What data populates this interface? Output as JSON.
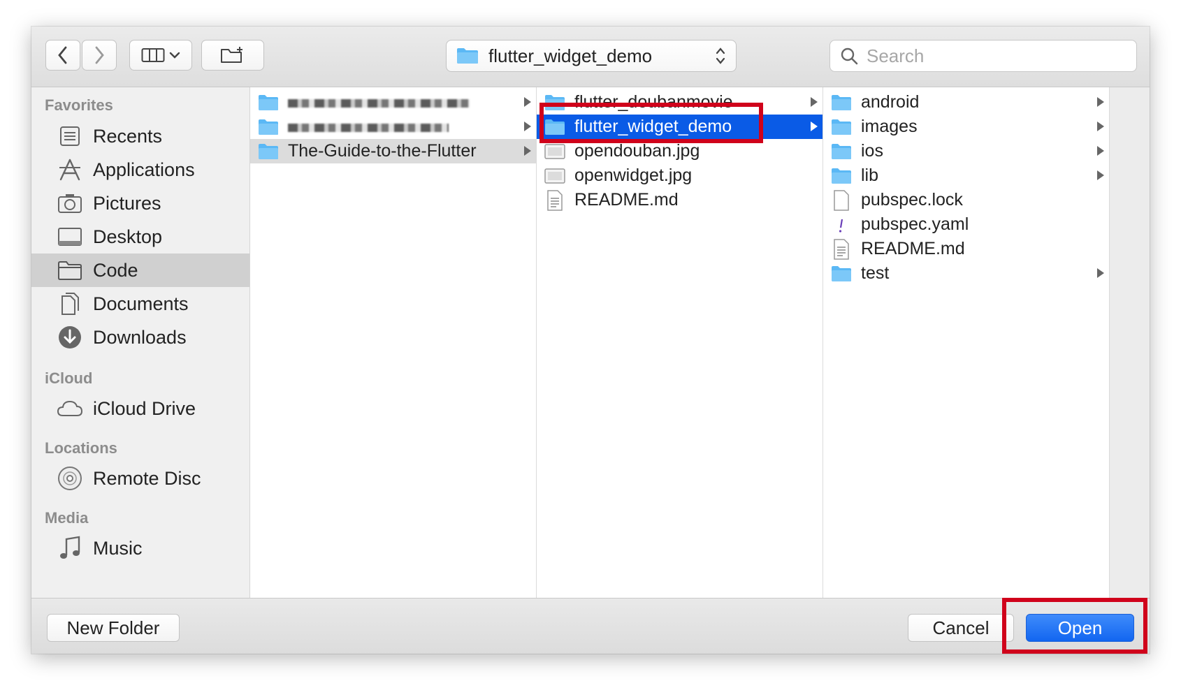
{
  "window": {
    "path_popup": {
      "label": "flutter_widget_demo"
    },
    "search": {
      "placeholder": "Search",
      "value": ""
    }
  },
  "toolbar": {
    "icons": [
      "chevron-left-icon",
      "chevron-right-icon",
      "column-view-icon",
      "chevron-down-icon",
      "new-folder-icon"
    ]
  },
  "sidebar": {
    "favorites_header": "Favorites",
    "favorites": [
      {
        "label": "Recents",
        "icon": "recents-icon"
      },
      {
        "label": "Applications",
        "icon": "applications-icon"
      },
      {
        "label": "Pictures",
        "icon": "camera-icon"
      },
      {
        "label": "Desktop",
        "icon": "desktop-icon"
      },
      {
        "label": "Code",
        "icon": "folder-icon",
        "selected": true
      },
      {
        "label": "Documents",
        "icon": "documents-icon"
      },
      {
        "label": "Downloads",
        "icon": "downloads-icon"
      }
    ],
    "icloud_header": "iCloud",
    "icloud": [
      {
        "label": "iCloud Drive",
        "icon": "cloud-icon"
      }
    ],
    "locations_header": "Locations",
    "locations": [
      {
        "label": "Remote Disc",
        "icon": "disc-icon"
      }
    ],
    "media_header": "Media",
    "media": [
      {
        "label": "Music",
        "icon": "music-note-icon"
      }
    ]
  },
  "columns": {
    "col1": [
      {
        "label": "",
        "obscured": true,
        "kind": "folder"
      },
      {
        "label": "",
        "obscured": true,
        "kind": "folder"
      },
      {
        "label": "The-Guide-to-the-Flutter",
        "kind": "folder",
        "selected": "grey"
      }
    ],
    "col2": [
      {
        "label": "flutter_doubanmovie",
        "kind": "folder"
      },
      {
        "label": "flutter_widget_demo",
        "kind": "folder",
        "selected": "blue"
      },
      {
        "label": "opendouban.jpg",
        "kind": "image"
      },
      {
        "label": "openwidget.jpg",
        "kind": "image"
      },
      {
        "label": "README.md",
        "kind": "text"
      }
    ],
    "col3": [
      {
        "label": "android",
        "kind": "folder"
      },
      {
        "label": "images",
        "kind": "folder"
      },
      {
        "label": "ios",
        "kind": "folder"
      },
      {
        "label": "lib",
        "kind": "folder"
      },
      {
        "label": "pubspec.lock",
        "kind": "file"
      },
      {
        "label": "pubspec.yaml",
        "kind": "yaml"
      },
      {
        "label": "README.md",
        "kind": "text"
      },
      {
        "label": "test",
        "kind": "folder"
      }
    ]
  },
  "buttons": {
    "new_folder": "New Folder",
    "cancel": "Cancel",
    "open": "Open"
  },
  "colors": {
    "selection_blue": "#0a5be6",
    "highlight_red": "#d0021b",
    "folder_blue": "#5bb8f5"
  }
}
